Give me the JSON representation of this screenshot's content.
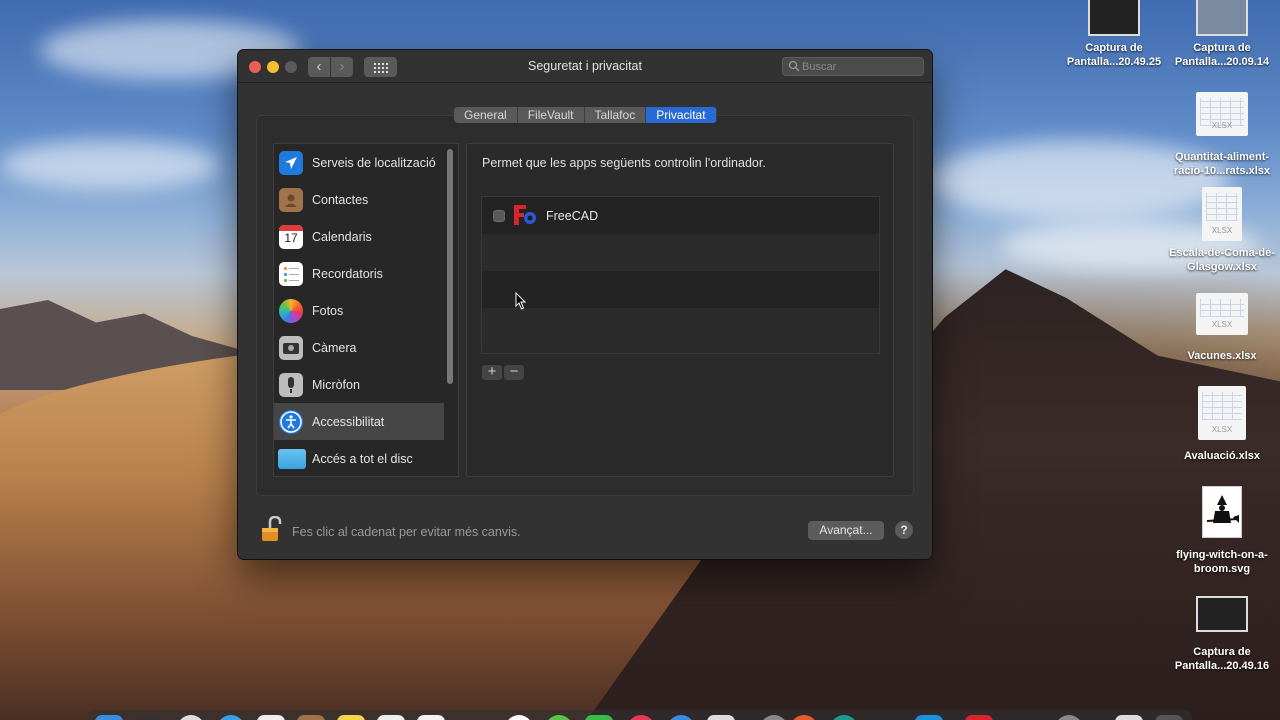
{
  "window": {
    "title": "Seguretat i privacitat",
    "search_placeholder": "Buscar",
    "tabs": [
      {
        "label": "General",
        "active": false
      },
      {
        "label": "FileVault",
        "active": false
      },
      {
        "label": "Tallafoc",
        "active": false
      },
      {
        "label": "Privacitat",
        "active": true
      }
    ],
    "sidebar": {
      "items": [
        {
          "label": "Serveis de localització",
          "icon": "location-arrow-icon"
        },
        {
          "label": "Contactes",
          "icon": "contacts-icon"
        },
        {
          "label": "Calendaris",
          "icon": "calendar-icon",
          "icon_text": "17"
        },
        {
          "label": "Recordatoris",
          "icon": "reminders-icon"
        },
        {
          "label": "Fotos",
          "icon": "photos-icon"
        },
        {
          "label": "Càmera",
          "icon": "camera-icon"
        },
        {
          "label": "Micròfon",
          "icon": "microphone-icon"
        },
        {
          "label": "Accessibilitat",
          "icon": "accessibility-icon",
          "selected": true
        },
        {
          "label": "Accés a tot el disc",
          "icon": "folder-icon"
        }
      ]
    },
    "content": {
      "description": "Permet que les apps següents controlin l'ordinador.",
      "apps": [
        {
          "name": "FreeCAD",
          "checked": false,
          "icon": "freecad-icon"
        }
      ],
      "add_label": "+",
      "remove_label": "−"
    },
    "footer": {
      "lock_message": "Fes clic al cadenat per evitar més canvis.",
      "advanced_label": "Avançat...",
      "help_label": "?"
    }
  },
  "desktop": {
    "icons": [
      {
        "label": "Captura de Pantalla...20.49.25",
        "kind": "screenshot"
      },
      {
        "label": "Captura de Pantalla...20.09.14",
        "kind": "screenshot"
      },
      {
        "label": "Quantitat-aliment-racio-10...rats.xlsx",
        "kind": "xlsx",
        "tag": "XLSX"
      },
      {
        "label": "Escala-de-Coma-de-Glasgow.xlsx",
        "kind": "xlsx",
        "tag": "XLSX"
      },
      {
        "label": "Vacunes.xlsx",
        "kind": "xlsx",
        "tag": "XLSX"
      },
      {
        "label": "Avaluació.xlsx",
        "kind": "xlsx",
        "tag": "XLSX"
      },
      {
        "label": "flying-witch-on-a-broom.svg",
        "kind": "svg"
      },
      {
        "label": "Captura de Pantalla...20.49.16",
        "kind": "screenshot"
      }
    ]
  },
  "colors": {
    "accent": "#2a6ad4",
    "window_bg": "#323232",
    "close": "#ec5f56",
    "minimize": "#f5bd30"
  }
}
